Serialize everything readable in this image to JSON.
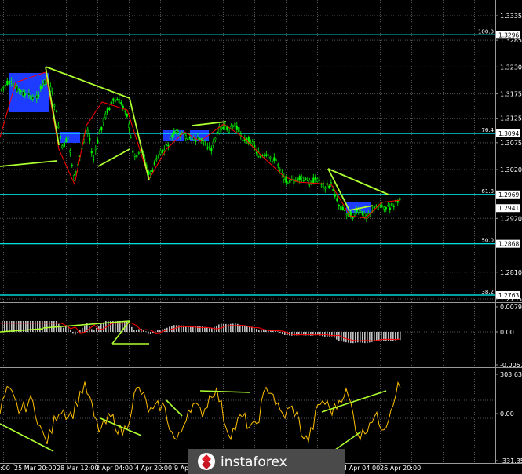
{
  "chart_data": [
    {
      "type": "candlestick",
      "price_axis_ticks": [
        "1.3335",
        "1.3285",
        "1.3230",
        "1.3175",
        "1.3125",
        "1.3075",
        "1.3020",
        "1.2920",
        "1.2810",
        "1.2755"
      ],
      "horizontal_levels": [
        {
          "fib": "100.0",
          "price": "1.3296"
        },
        {
          "fib": "76.4",
          "price": "1.3094"
        },
        {
          "fib": "61.8",
          "price": "1.2969"
        },
        {
          "fib": "50.0",
          "price": "1.2868"
        },
        {
          "fib": "38.2",
          "price": "1.2763"
        }
      ],
      "current_price": "1.2941",
      "colors": {
        "bull": "#00ff00",
        "bear": "#00ff00",
        "levels": "#00ffff",
        "zigzag": "#ff0000",
        "trendlines": "#adff2f",
        "zones": "#1e3cff"
      }
    },
    {
      "type": "histogram",
      "indicator": "MACD",
      "axis_ticks": [
        "0.00798",
        "0.00",
        "-0.00571"
      ],
      "colors": {
        "histogram": "#c0c0c0",
        "signal": "#ff0000",
        "divergence": "#adff2f"
      }
    },
    {
      "type": "line",
      "indicator": "CCI",
      "axis_ticks": [
        "303.6317",
        "0.00",
        "-331.359"
      ],
      "colors": {
        "line": "#ffc000",
        "divergence": "#adff2f"
      }
    }
  ],
  "time_axis": [
    "25 Mar 20:00",
    "28 Mar 12:00",
    "2 Apr 04:00",
    "4 Apr 20:00",
    "9 Apr",
    "24 Apr 04:00",
    "26 Apr 20:00"
  ],
  "time_axis_clipped_left": ":00",
  "logo": {
    "text": "instaforex"
  }
}
